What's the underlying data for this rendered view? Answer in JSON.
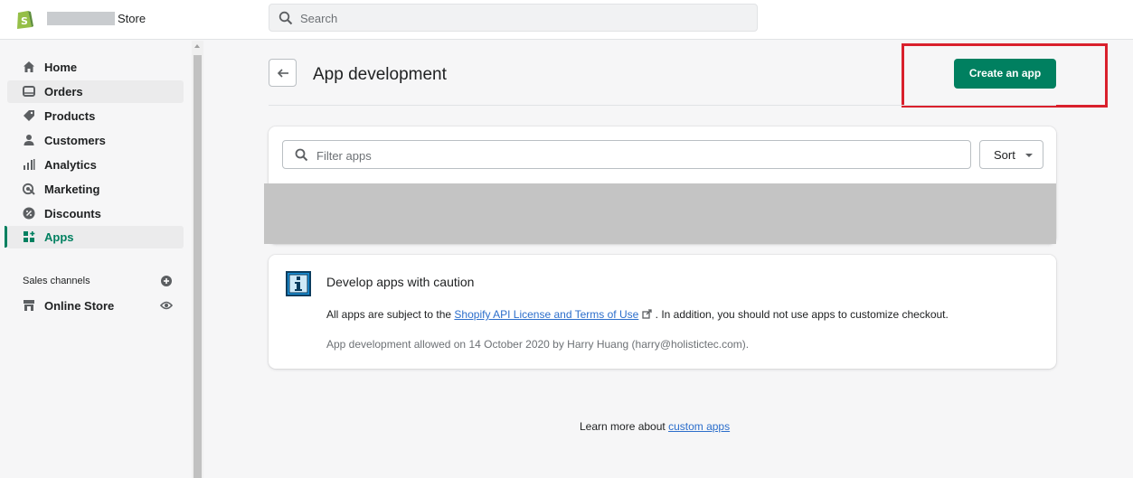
{
  "topbar": {
    "store_suffix": "Store",
    "search_placeholder": "Search"
  },
  "sidebar": {
    "items": [
      {
        "label": "Home",
        "icon": "home-icon"
      },
      {
        "label": "Orders",
        "icon": "orders-icon"
      },
      {
        "label": "Products",
        "icon": "tag-icon"
      },
      {
        "label": "Customers",
        "icon": "person-icon"
      },
      {
        "label": "Analytics",
        "icon": "bar-chart-icon"
      },
      {
        "label": "Marketing",
        "icon": "target-icon"
      },
      {
        "label": "Discounts",
        "icon": "discount-icon"
      },
      {
        "label": "Apps",
        "icon": "apps-icon"
      }
    ],
    "active_item": "Apps",
    "sales_channels_label": "Sales channels",
    "online_store_label": "Online Store"
  },
  "page": {
    "title": "App development",
    "create_button": "Create an app",
    "filter_placeholder": "Filter apps",
    "sort_label": "Sort"
  },
  "caution": {
    "title": "Develop apps with caution",
    "line_prefix": "All apps are subject to the ",
    "link_text": "Shopify API License and Terms of Use",
    "line_suffix": " . In addition, you should not use apps to customize checkout.",
    "allowed_text": "App development allowed on 14 October 2020 by Harry Huang (harry@holistictec.com)."
  },
  "footer": {
    "learn_prefix": "Learn more about ",
    "learn_link": "custom apps"
  },
  "colors": {
    "accent": "#008060",
    "link": "#2c6ecb",
    "highlight": "#d9202c"
  }
}
